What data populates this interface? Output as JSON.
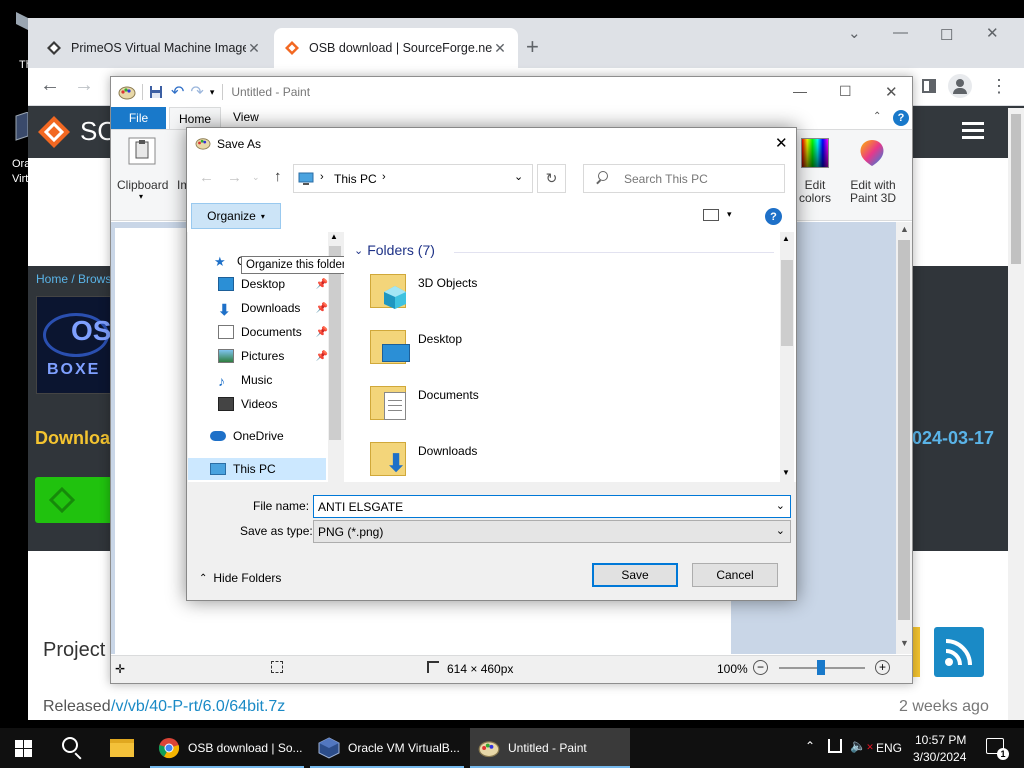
{
  "desktop": {
    "icons": [
      {
        "label": "Th"
      },
      {
        "label": "Ora"
      },
      {
        "label": "Virt"
      }
    ]
  },
  "browser": {
    "tabs": [
      {
        "title": "PrimeOS Virtual Machine Image",
        "active": false
      },
      {
        "title": "OSB download | SourceForge.net",
        "active": true
      }
    ],
    "site": {
      "logo_text": "SO",
      "breadcrumb": "Home / Brows",
      "image_label_top": "OS",
      "image_label_bottom": "BOXE",
      "download_heading": "Downloa",
      "date_text": "024-03-17",
      "project_heading": "Project",
      "released_label": "Released",
      "released_path": "/v/vb/40-P-rt/6.0/64bit.7z",
      "released_ago": "2 weeks ago"
    }
  },
  "paint": {
    "title": "Untitled - Paint",
    "tabs": [
      "File",
      "Home",
      "View"
    ],
    "ribbon": {
      "clipboard_label": "Clipboard",
      "image_label": "Im",
      "edit_colors_label": "Edit\ncolors",
      "edit_colors_line1": "Edit",
      "edit_colors_line2": "colors",
      "paint3d_line1": "Edit with",
      "paint3d_line2": "Paint 3D"
    },
    "status": {
      "dimensions": "614 × 460px",
      "zoom": "100%"
    }
  },
  "dialog": {
    "title": "Save As",
    "breadcrumb_location": "This PC",
    "search_placeholder": "Search This PC",
    "organize_label": "Organize",
    "tooltip": "Organize this folder's contents.",
    "nav_items": [
      {
        "label": "Quick access",
        "icon": "star-icon"
      },
      {
        "label": "Desktop",
        "icon": "desktop-icon",
        "pinned": true
      },
      {
        "label": "Downloads",
        "icon": "download-icon",
        "pinned": true
      },
      {
        "label": "Documents",
        "icon": "documents-icon",
        "pinned": true
      },
      {
        "label": "Pictures",
        "icon": "pictures-icon",
        "pinned": true
      },
      {
        "label": "Music",
        "icon": "music-icon"
      },
      {
        "label": "Videos",
        "icon": "videos-icon"
      },
      {
        "label": "OneDrive",
        "icon": "cloud-icon"
      },
      {
        "label": "This PC",
        "icon": "pc-icon",
        "selected": true
      }
    ],
    "quick_access_visible": "Q",
    "folders_header": "Folders (7)",
    "folders": [
      {
        "name": "3D Objects",
        "overlay": "cube"
      },
      {
        "name": "Desktop",
        "overlay": "desktop"
      },
      {
        "name": "Documents",
        "overlay": "doc"
      },
      {
        "name": "Downloads",
        "overlay": "download"
      }
    ],
    "file_name_label": "File name:",
    "file_name_value": "ANTI ELSGATE",
    "save_type_label": "Save as type:",
    "save_type_value": "PNG (*.png)",
    "hide_folders_label": "Hide Folders",
    "save_label": "Save",
    "cancel_label": "Cancel"
  },
  "taskbar": {
    "items": [
      {
        "label": "OSB download | So...",
        "icon": "chrome-icon"
      },
      {
        "label": "Oracle VM VirtualB...",
        "icon": "virtualbox-icon"
      },
      {
        "label": "Untitled - Paint",
        "icon": "paint-icon"
      }
    ],
    "language": "ENG",
    "time": "10:57 PM",
    "date": "3/30/2024",
    "notification_count": "1"
  },
  "colors": {
    "accent": "#0078d7",
    "sf_orange": "#f26822",
    "download_yellow": "#f4c430",
    "green_button": "#20c20e",
    "rss_blue": "#1a8ac6"
  }
}
